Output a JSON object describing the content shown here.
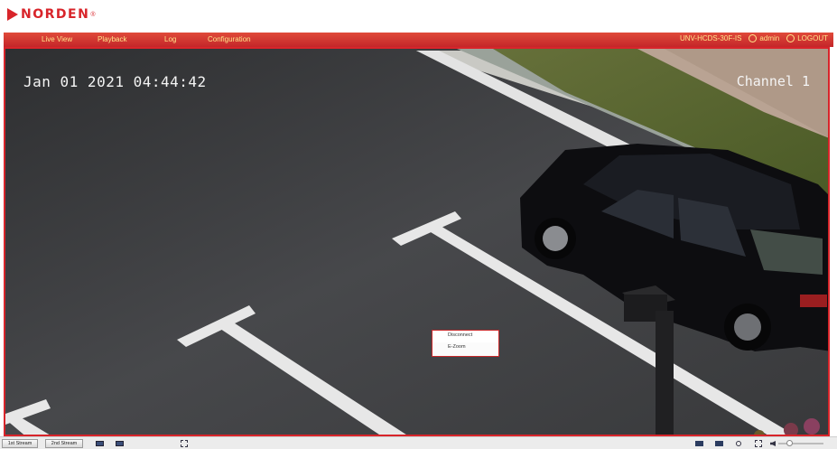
{
  "brand": {
    "name": "NORDEN",
    "reg": "®"
  },
  "nav": {
    "items": [
      "Live View",
      "Playback",
      "Log",
      "Configuration"
    ],
    "device": "UNV-HCDS-30F-IS",
    "user": "admin",
    "logout": "LOGOUT"
  },
  "video": {
    "timestamp": "Jan 01 2021 04:44:42",
    "channel": "Channel 1"
  },
  "context_menu": {
    "items": [
      "Disconnect",
      "E-Zoom"
    ]
  },
  "toolbar": {
    "stream1": "1st Stream",
    "stream2": "2nd Stream",
    "icons": [
      "layout-1-icon",
      "layout-4-icon",
      "window-ratio-icon",
      "record-icon",
      "snapshot-icon",
      "zoom-icon",
      "fullscreen-icon",
      "volume-icon"
    ],
    "volume": 0.2
  },
  "colors": {
    "accent": "#d8242a",
    "nav_text": "#ffe58a"
  }
}
